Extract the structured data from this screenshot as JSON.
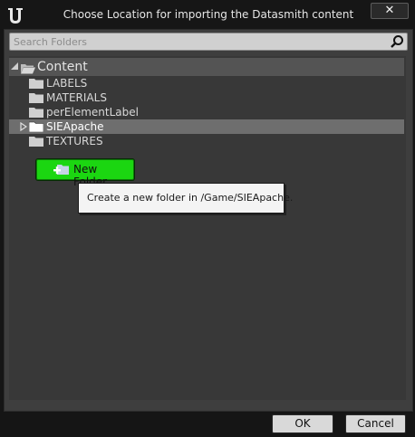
{
  "window": {
    "title": "Choose Location for importing the Datasmith content",
    "close_glyph": "✕"
  },
  "search": {
    "placeholder": "Search Folders",
    "value": ""
  },
  "tree": {
    "root": {
      "label": "Content",
      "expanded": true
    },
    "items": [
      {
        "label": "LABELS",
        "selected": false,
        "has_children": false
      },
      {
        "label": "MATERIALS",
        "selected": false,
        "has_children": false
      },
      {
        "label": "perElementLabel",
        "selected": false,
        "has_children": false
      },
      {
        "label": "SIEApache",
        "selected": true,
        "has_children": true
      },
      {
        "label": "TEXTURES",
        "selected": false,
        "has_children": false
      }
    ]
  },
  "new_folder": {
    "label": "New Folder",
    "tooltip": "Create a new folder in /Game/SIEApache."
  },
  "footer": {
    "ok_label": "OK",
    "cancel_label": "Cancel"
  },
  "colors": {
    "new_folder_button": "#1bd611",
    "selected_row": "#6e6e6e",
    "panel": "#3e3e3e"
  },
  "icons": {
    "logo": "unreal-logo-icon",
    "search": "search-icon",
    "folder": "folder-icon",
    "new_folder": "new-folder-icon"
  }
}
